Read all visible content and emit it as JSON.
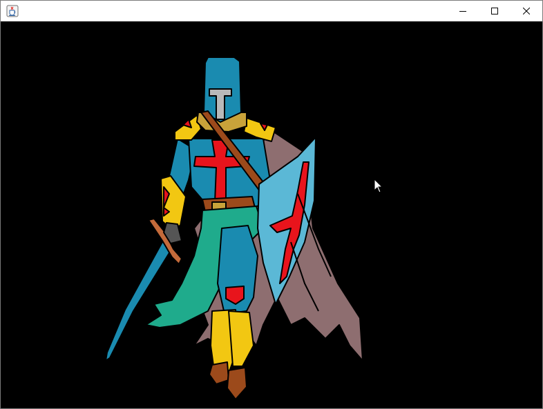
{
  "window": {
    "title": "",
    "app_icon": "java-cup-icon",
    "controls": {
      "minimize": "minimize-icon",
      "maximize": "maximize-icon",
      "close": "close-icon"
    }
  },
  "canvas": {
    "background": "#000000",
    "illustration": "crusader-knight",
    "colors": {
      "armor_teal": "#1a8bb0",
      "cross_red": "#e8141c",
      "gold": "#f2c712",
      "shield_light": "#5bb8d6",
      "cape_mauve": "#8e6e70",
      "tunic_green": "#1fab8c",
      "belt_brown": "#9c4a1b"
    }
  }
}
